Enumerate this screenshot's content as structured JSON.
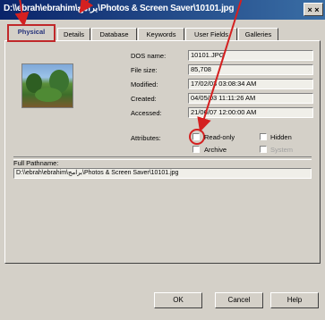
{
  "title": "D:\\\\ebrah\\ebrahim\\برامج\\Photos & Screen Saver\\10101.jpg",
  "tabs": [
    "Physical",
    "Details",
    "Database",
    "Keywords",
    "User Fields",
    "Galleries"
  ],
  "fields": {
    "dos_name_label": "DOS name:",
    "dos_name_value": "10101.JPG",
    "file_size_label": "File size:",
    "file_size_value": "85,708",
    "modified_label": "Modified:",
    "modified_value": "17/02/03 03:08:34 AM",
    "created_label": "Created:",
    "created_value": "04/05/03 11:11:26 AM",
    "accessed_label": "Accessed:",
    "accessed_value": "21/06/07 12:00:00 AM"
  },
  "attributes": {
    "label": "Attributes:",
    "read_only": "Read-only",
    "hidden": "Hidden",
    "archive": "Archive",
    "system": "System"
  },
  "full_path": {
    "label": "Full Pathname:",
    "value": "D:\\\\ebrah\\ebrahim\\برامج\\Photos & Screen Saver\\10101.jpg"
  },
  "buttons": {
    "ok": "OK",
    "cancel": "Cancel",
    "help": "Help"
  },
  "colors": {
    "annotation": "#d42020",
    "titlebar": "#0a246a"
  },
  "window_close_symbol": "× ×"
}
